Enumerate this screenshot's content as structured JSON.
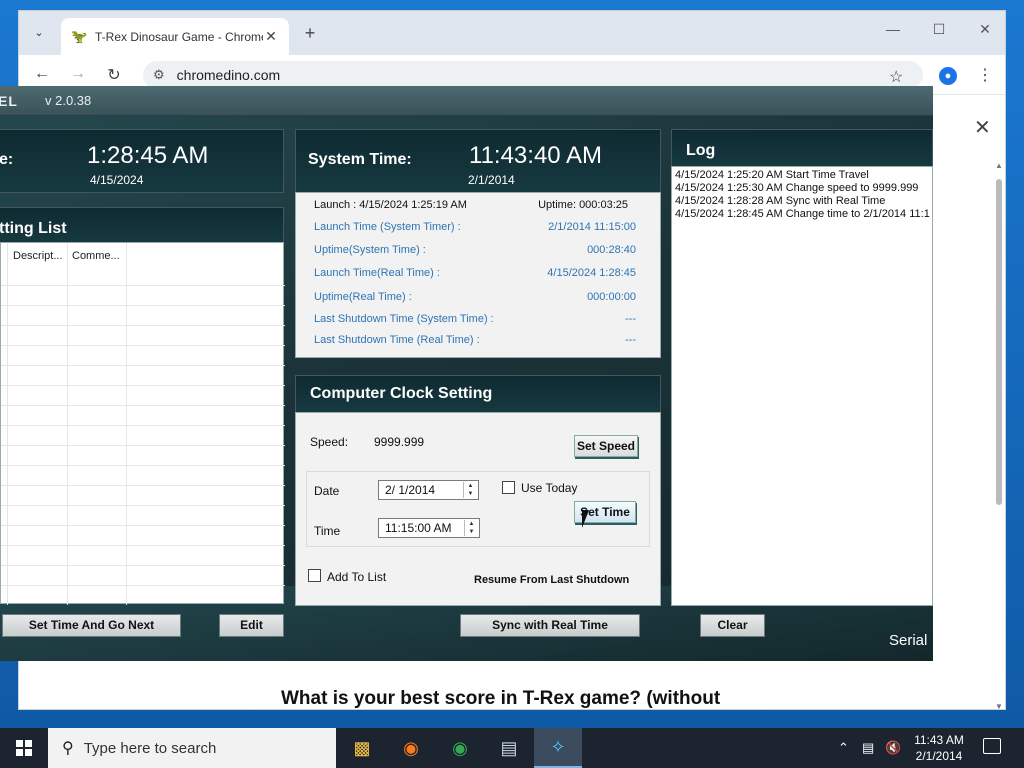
{
  "browser": {
    "tab_title": "T-Rex Dinosaur Game - Chrome",
    "url": "chromedino.com",
    "page_heading": "What is your best score in T-Rex game? (without"
  },
  "app": {
    "name": "EL",
    "version": "v 2.0.38",
    "current_time_label": "e:",
    "current_time": "1:28:45 AM",
    "current_date": "4/15/2024",
    "system_time_label": "System Time:",
    "system_time": "11:43:40 AM",
    "system_date": "2/1/2014",
    "setting_list_title": "tting List",
    "setting_list_columns": [
      "Descript...",
      "Comme..."
    ],
    "info": {
      "launch": "Launch : 4/15/2024 1:25:19 AM",
      "uptime": "Uptime: 000:03:25",
      "rows": [
        {
          "k": "Launch Time (System Timer) :",
          "v": "2/1/2014 11:15:00"
        },
        {
          "k": "Uptime(System Time) :",
          "v": "000:28:40"
        },
        {
          "k": "Launch Time(Real Time) :",
          "v": "4/15/2024 1:28:45"
        },
        {
          "k": "Uptime(Real Time) :",
          "v": "000:00:00"
        },
        {
          "k": "Last Shutdown Time (System Time) :",
          "v": "---"
        },
        {
          "k": "Last Shutdown Time (Real Time) :",
          "v": "---"
        }
      ]
    },
    "clock_setting": {
      "title": "Computer Clock Setting",
      "speed_label": "Speed:",
      "speed_value": "9999.999",
      "set_speed": "Set Speed",
      "date_label": "Date",
      "date_value": "2/ 1/2014",
      "time_label": "Time",
      "time_value": "11:15:00 AM",
      "use_today": "Use Today",
      "set_time": "Set Time",
      "add_to_list": "Add To List",
      "resume": "Resume From Last Shutdown"
    },
    "log": {
      "title": "Log",
      "entries": [
        "4/15/2024 1:25:20 AM  Start Time Travel",
        "4/15/2024 1:25:30 AM  Change speed to 9999.999",
        "4/15/2024 1:28:28 AM  Sync with Real Time",
        "4/15/2024 1:28:45 AM  Change time to 2/1/2014 11:1"
      ]
    },
    "buttons": {
      "set_time_go_next": "Set Time And Go Next",
      "edit": "Edit",
      "sync": "Sync with Real Time",
      "clear": "Clear"
    },
    "serial": "Serial"
  },
  "taskbar": {
    "search_placeholder": "Type here to search",
    "clock_time": "11:43 AM",
    "clock_date": "2/1/2014"
  },
  "colors": {
    "info_blue": "#2f74b5",
    "app_bg": "#1b3338",
    "accent": "#7fb2e5"
  }
}
